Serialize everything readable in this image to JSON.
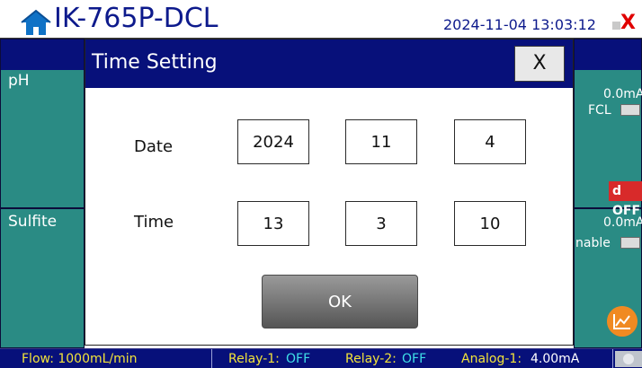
{
  "header": {
    "title": "IK-765P-DCL",
    "datetime": "2024-11-04 13:03:12",
    "alarm_symbol": "X",
    "icon": "home-icon"
  },
  "panels": {
    "top_left_label": "pH",
    "top_right_current": "0.0mA",
    "top_right_name": "FCL",
    "status_badge": "d OFF",
    "bottom_left_label": "Sulfite",
    "bottom_right_current": "0.0mA",
    "bottom_right_name": "nable"
  },
  "dialog": {
    "title": "Time Setting",
    "close_label": "X",
    "date_label": "Date",
    "time_label": "Time",
    "date_values": [
      "2024",
      "11",
      "4"
    ],
    "time_values": [
      "13",
      "3",
      "10"
    ],
    "ok_label": "OK"
  },
  "statusbar": {
    "flow": "Flow: 1000mL/min",
    "relay1_label": "Relay-1:",
    "relay1_value": "OFF",
    "relay2_label": "Relay-2:",
    "relay2_value": "OFF",
    "analog1_label": "Analog-1:",
    "analog1_value": "4.00mA"
  },
  "colors": {
    "header_blue": "#07107a",
    "panel_teal": "#2a8b84",
    "status_yellow": "#f2e33a",
    "status_cyan": "#3fe0e8",
    "alarm_red": "#e00000",
    "chart_orange": "#f08a22"
  },
  "icons": {
    "home": "home-icon",
    "chart": "line-chart-icon",
    "settings": "gear-icon"
  }
}
